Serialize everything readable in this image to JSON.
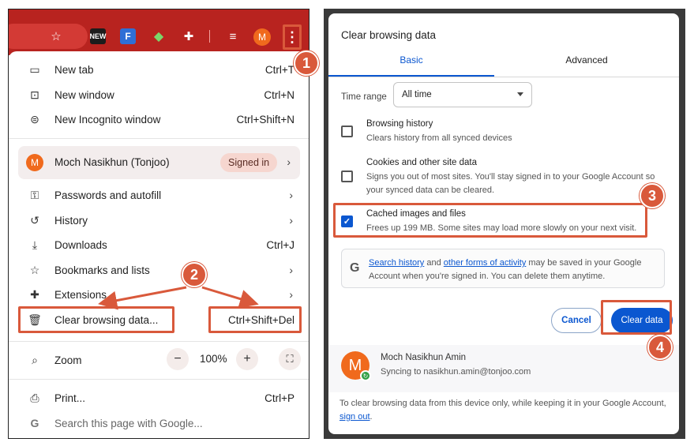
{
  "chrome_menu": {
    "items": [
      {
        "label": "New tab",
        "shortcut": "Ctrl+T"
      },
      {
        "label": "New window",
        "shortcut": "Ctrl+N"
      },
      {
        "label": "New Incognito window",
        "shortcut": "Ctrl+Shift+N"
      }
    ],
    "profile": {
      "initial": "M",
      "name": "Moch Nasikhun (Tonjoo)",
      "badge": "Signed in"
    },
    "items2": [
      {
        "label": "Passwords and autofill"
      },
      {
        "label": "History"
      },
      {
        "label": "Downloads",
        "shortcut": "Ctrl+J"
      },
      {
        "label": "Bookmarks and lists"
      },
      {
        "label": "Extensions"
      }
    ],
    "clear_item": {
      "label": "Clear browsing data...",
      "shortcut": "Ctrl+Shift+Del"
    },
    "zoom": {
      "label": "Zoom",
      "value": "100%",
      "minus": "−",
      "plus": "+"
    },
    "print": {
      "label": "Print...",
      "shortcut": "Ctrl+P"
    },
    "search": {
      "label": "Search this page with Google..."
    }
  },
  "toolbar": {
    "avatar_initial": "M",
    "ext_new": "NEW",
    "ext_f": "F"
  },
  "dialog": {
    "title": "Clear browsing data",
    "tabs": [
      "Basic",
      "Advanced"
    ],
    "time_range": {
      "label": "Time range",
      "value": "All time"
    },
    "options": [
      {
        "title": "Browsing history",
        "desc": "Clears history from all synced devices",
        "checked": false
      },
      {
        "title": "Cookies and other site data",
        "desc": "Signs you out of most sites. You'll stay signed in to your Google Account so your synced data can be cleared.",
        "checked": false
      },
      {
        "title": "Cached images and files",
        "desc": "Frees up 199 MB. Some sites may load more slowly on your next visit.",
        "checked": true
      }
    ],
    "info": {
      "link1": "Search history",
      "and": " and ",
      "link2": "other forms of activity",
      "rest": " may be saved in your Google Account when you're signed in. You can delete them anytime."
    },
    "cancel": "Cancel",
    "clear": "Clear data",
    "account": {
      "initial": "M",
      "name": "Moch Nasikhun Amin",
      "sync": "Syncing to nasikhun.amin@tonjoo.com"
    },
    "footer": {
      "text": "To clear browsing data from this device only, while keeping it in your Google Account, ",
      "link": "sign out",
      "end": "."
    }
  },
  "steps": [
    "1",
    "2",
    "3",
    "4"
  ],
  "colors": {
    "accent": "#d9593b",
    "blue": "#0b57d0",
    "toolbar": "#b8231f"
  }
}
